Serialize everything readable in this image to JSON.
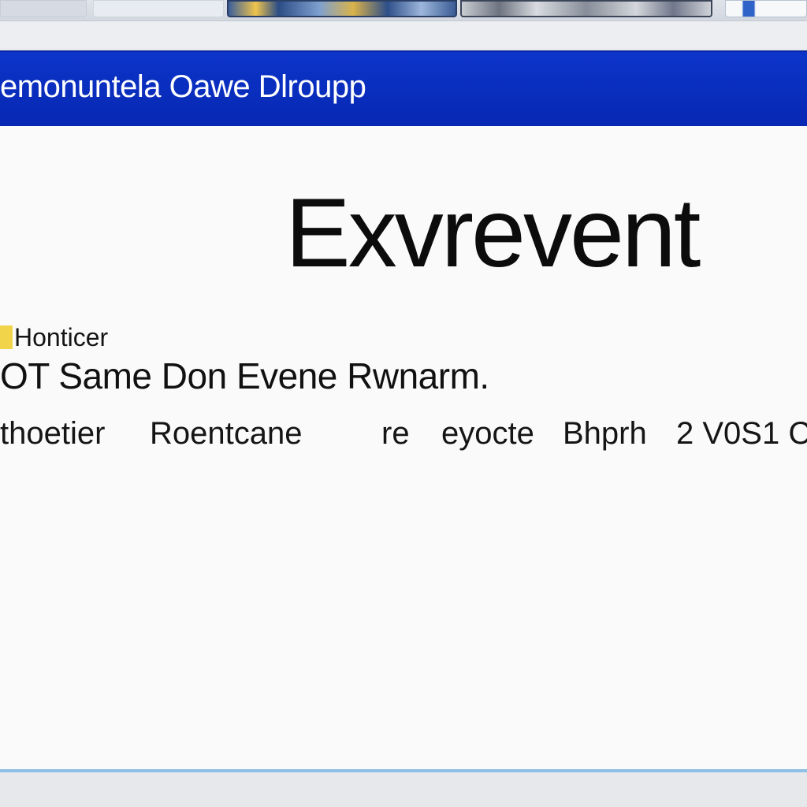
{
  "window": {
    "title": "emonuntela Oawe Dlroupp"
  },
  "main": {
    "heading": "Exvrevent",
    "label": "Honticer",
    "subheading": "OT Same Don Evene Rwnarm.",
    "details": [
      "thoetier",
      "Roentcane",
      "re",
      "eyocte",
      "Bhprh",
      "2 V0S1 C"
    ]
  },
  "colors": {
    "title_bar": "#0a2fc0",
    "label_marker": "#f2d44a",
    "window_border": "#8ebfe6"
  }
}
